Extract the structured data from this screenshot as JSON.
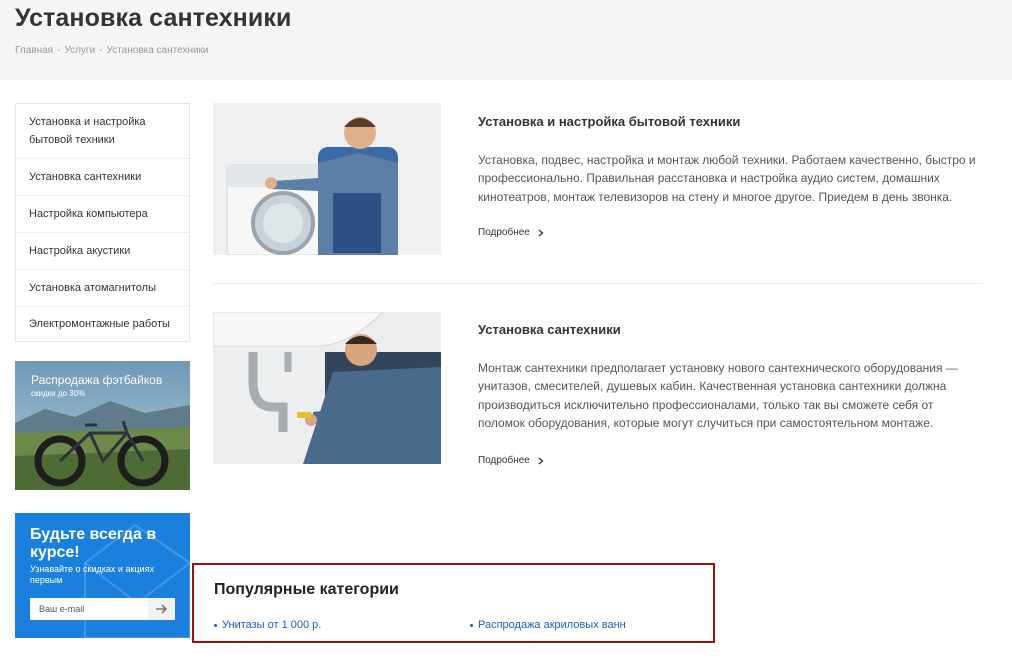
{
  "page": {
    "title": "Установка сантехники",
    "breadcrumb": [
      "Главная",
      "Услуги",
      "Установка сантехники"
    ]
  },
  "sidebar": {
    "items": [
      {
        "label": "Установка и настройка бытовой техники"
      },
      {
        "label": "Установка сантехники"
      },
      {
        "label": "Настройка компьютера"
      },
      {
        "label": "Настройка акустики"
      },
      {
        "label": "Установка атомагнитолы"
      },
      {
        "label": "Электромонтажные работы"
      }
    ]
  },
  "promo": {
    "title": "Распродажа фэтбайков",
    "subtitle": "скидки до 30%"
  },
  "subscribe": {
    "title": "Будьте всегда в курсе!",
    "subtitle": "Узнавайте о скидках и акциях первым",
    "input_placeholder": "Ваш e-mail"
  },
  "services": [
    {
      "title": "Установка и настройка бытовой техники",
      "text": "Установка, подвес, настройка и монтаж любой техники. Работаем качественно, быстро и профессионально. Правильная расстановка и настройка аудио систем, домашних кинотеатров, монтаж телевизоров на стену и многое другое. Приедем в день звонка.",
      "more": "Подробнее"
    },
    {
      "title": "Установка сантехники",
      "text": "Монтаж сантехники предполагает установку нового сантехнического оборудования — унитазов, смесителей, душевых кабин. Качественная установка сантехники должна производиться исключительно профессионалами, только так вы сможете себя от поломок оборудования, которые могут случиться при самостоятельном монтаже.",
      "more": "Подробнее"
    }
  ],
  "popular": {
    "title": "Популярные категории",
    "links": [
      "Унитазы от 1 000 р.",
      "Распродажа акриловых ванн"
    ]
  },
  "colors": {
    "accent_blue": "#1a7fdd",
    "link_blue": "#1a5fb4",
    "highlight_border": "#9b0f0f"
  }
}
